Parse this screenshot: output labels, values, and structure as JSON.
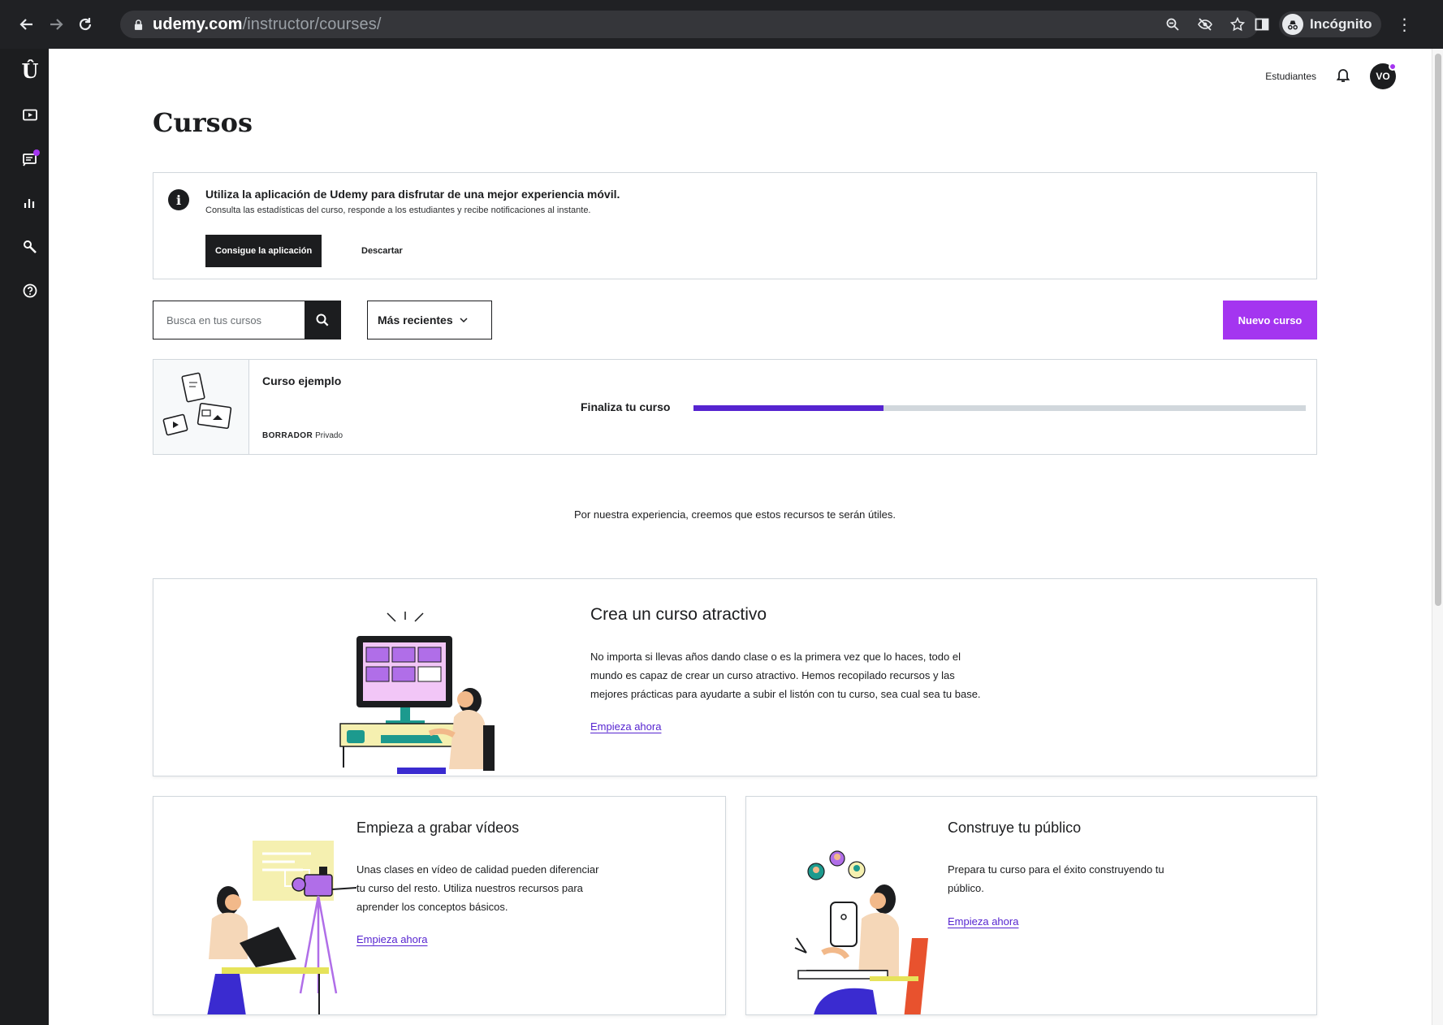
{
  "browser": {
    "url_domain": "udemy.com",
    "url_path": "/instructor/courses/",
    "profile_label": "Incógnito"
  },
  "sidebar": {
    "logo": "Û",
    "items": [
      "courses-icon",
      "communication-icon",
      "performance-icon",
      "tools-icon",
      "help-icon"
    ]
  },
  "header": {
    "students_link": "Estudiantes",
    "avatar_initials": "VO"
  },
  "page": {
    "title": "Cursos"
  },
  "banner": {
    "heading": "Utiliza la aplicación de Udemy para disfrutar de una mejor experiencia móvil.",
    "subtext": "Consulta las estadísticas del curso, responde a los estudiantes y recibe notificaciones al instante.",
    "get_app_label": "Consigue la aplicación",
    "dismiss_label": "Descartar"
  },
  "toolbar": {
    "search_placeholder": "Busca en tus cursos",
    "sort_label": "Más recientes",
    "new_course_label": "Nuevo curso"
  },
  "course": {
    "title": "Curso ejemplo",
    "status": "BORRADOR",
    "visibility": "Privado",
    "finish_label": "Finaliza tu curso",
    "progress": 0.31
  },
  "resources": {
    "intro": "Por nuestra experiencia, creemos que estos recursos te serán útiles.",
    "cards": [
      {
        "title": "Crea un curso atractivo",
        "desc_lines": [
          "No importa si llevas años dando clase o es la primera vez que lo haces, todo el",
          "mundo es capaz de crear un curso atractivo. Hemos recopilado recursos y las",
          "mejores prácticas para ayudarte a subir el listón con tu curso, sea cual sea tu base."
        ],
        "link": "Empieza ahora"
      },
      {
        "title": "Empieza a grabar vídeos",
        "desc_lines": [
          "Unas clases en vídeo de calidad pueden diferenciar",
          "tu curso del resto. Utiliza nuestros recursos para",
          "aprender los conceptos básicos."
        ],
        "link": "Empieza ahora"
      },
      {
        "title": "Construye tu público",
        "desc_lines": [
          "Prepara tu curso para el éxito construyendo tu",
          "público."
        ],
        "link": "Empieza ahora"
      }
    ]
  },
  "colors": {
    "brand_purple": "#a435f0",
    "progress_fill": "#5624d0",
    "dark": "#1c1d1f",
    "border": "#d1d7dc"
  }
}
